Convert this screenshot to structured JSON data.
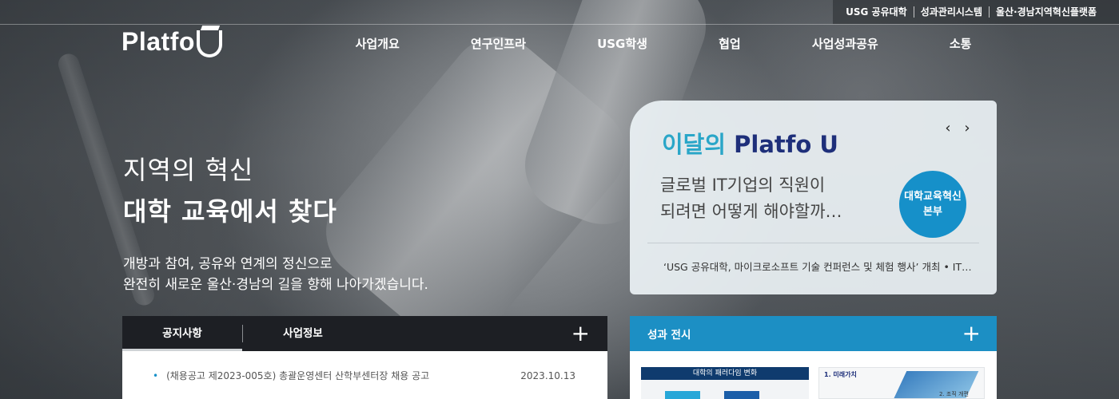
{
  "utility_links": [
    "USG 공유대학",
    "성과관리시스템",
    "울산·경남지역혁신플랫폼"
  ],
  "logo": {
    "text": "Platfo"
  },
  "nav": [
    "사업개요",
    "연구인프라",
    "USG학생",
    "협업",
    "사업성과공유",
    "소통"
  ],
  "hero": {
    "title_line1": "지역의 혁신",
    "title_line2": "대학 교육에서 찾다",
    "desc_line1": "개방과 참여, 공유와 연계의 정신으로",
    "desc_line2": "완전히 새로운 울산·경남의 길을 향해 나아가겠습니다."
  },
  "month_card": {
    "title_accent": "이달의",
    "title_name": "Platfo U",
    "prev_icon": "‹",
    "next_icon": "›",
    "body_line1": "글로벌 IT기업의 직원이",
    "body_line2": "되려면 어떻게 해야할까…",
    "badge_line1": "대학교육혁신",
    "badge_line2": "본부",
    "footer": "‘USG 공유대학, 마이크로소프트 기술 컨퍼런스 및 체험 행사’ 개최 • IT…"
  },
  "notice": {
    "tabs": [
      "공지사항",
      "사업정보"
    ],
    "plus": "+",
    "items": [
      {
        "title": "(채용공고 제2023-005호) 총괄운영센터 산학부센터장 채용 공고",
        "date": "2023.10.13"
      }
    ]
  },
  "gallery": {
    "title": "성과 전시",
    "plus": "+",
    "thumb1_title": "대학의 패러다임 변화",
    "thumb2_label": "1. 미래가치",
    "thumb2_label2": "2. 조직 개편"
  },
  "colors": {
    "accent_teal": "#2aa6c8",
    "brand_navy": "#1e2f7a",
    "badge_blue": "#1690c9",
    "gallery_header": "#1c8fc4",
    "notice_header": "#1d1f24"
  }
}
